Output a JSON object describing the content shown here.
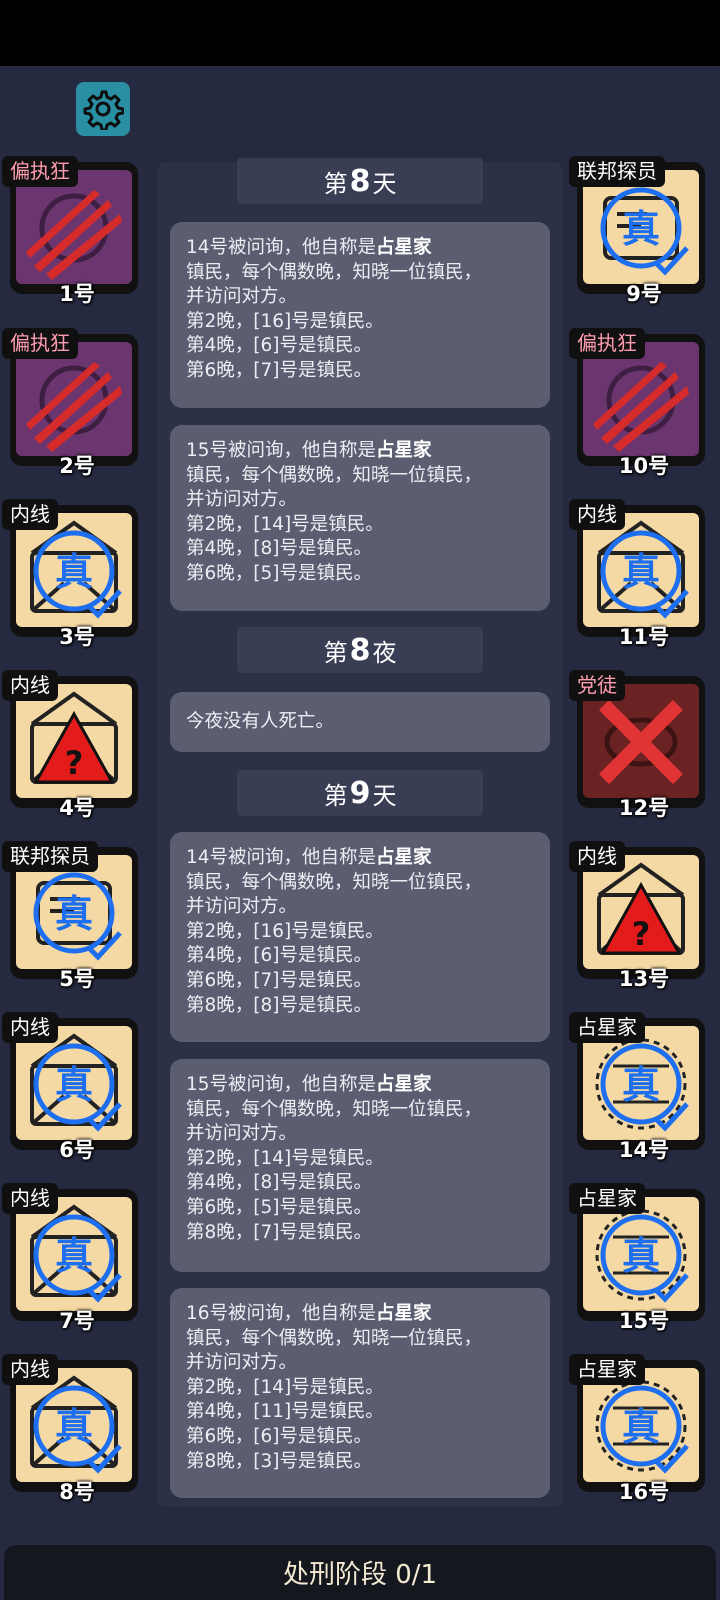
{
  "settings": {
    "icon": "gear-icon"
  },
  "log": {
    "headers": [
      {
        "prefix": "第",
        "number": "8",
        "suffix": "天"
      },
      {
        "prefix": "第",
        "number": "8",
        "suffix": "夜"
      },
      {
        "prefix": "第",
        "number": "9",
        "suffix": "天"
      }
    ],
    "cards": [
      {
        "intro": "14号被问询，他自称是",
        "role": "占星家",
        "lines": [
          "镇民，每个偶数晚，知晓一位镇民，",
          "并访问对方。",
          "第2晚，[16]号是镇民。",
          "第4晚，[6]号是镇民。",
          "第6晚，[7]号是镇民。"
        ]
      },
      {
        "intro": "15号被问询，他自称是",
        "role": "占星家",
        "lines": [
          "镇民，每个偶数晚，知晓一位镇民，",
          "并访问对方。",
          "第2晚，[14]号是镇民。",
          "第4晚，[8]号是镇民。",
          "第6晚，[5]号是镇民。"
        ]
      },
      {
        "intro": "今夜没有人死亡。",
        "role": "",
        "lines": []
      },
      {
        "intro": "14号被问询，他自称是",
        "role": "占星家",
        "lines": [
          "镇民，每个偶数晚，知晓一位镇民，",
          "并访问对方。",
          "第2晚，[16]号是镇民。",
          "第4晚，[6]号是镇民。",
          "第6晚，[7]号是镇民。",
          "第8晚，[8]号是镇民。"
        ]
      },
      {
        "intro": "15号被问询，他自称是",
        "role": "占星家",
        "lines": [
          "镇民，每个偶数晚，知晓一位镇民，",
          "并访问对方。",
          "第2晚，[14]号是镇民。",
          "第4晚，[8]号是镇民。",
          "第6晚，[5]号是镇民。",
          "第8晚，[7]号是镇民。"
        ]
      },
      {
        "intro": "16号被问询，他自称是",
        "role": "占星家",
        "lines": [
          "镇民，每个偶数晚，知晓一位镇民，",
          "并访问对方。",
          "第2晚，[14]号是镇民。",
          "第4晚，[11]号是镇民。",
          "第6晚，[6]号是镇民。",
          "第8晚，[3]号是镇民。"
        ]
      }
    ]
  },
  "players": [
    {
      "tag": "偏执狂",
      "number": "1号",
      "icon": "claw-mark-icon"
    },
    {
      "tag": "偏执狂",
      "number": "2号",
      "icon": "claw-mark-icon"
    },
    {
      "tag": "内线",
      "number": "3号",
      "icon": "verified-envelope-icon",
      "stamp": "真"
    },
    {
      "tag": "内线",
      "number": "4号",
      "icon": "warning-envelope-icon"
    },
    {
      "tag": "联邦探员",
      "number": "5号",
      "icon": "verified-badge-icon",
      "stamp": "真"
    },
    {
      "tag": "内线",
      "number": "6号",
      "icon": "verified-envelope-icon",
      "stamp": "真"
    },
    {
      "tag": "内线",
      "number": "7号",
      "icon": "verified-envelope-icon",
      "stamp": "真"
    },
    {
      "tag": "内线",
      "number": "8号",
      "icon": "verified-envelope-icon",
      "stamp": "真"
    },
    {
      "tag": "联邦探员",
      "number": "9号",
      "icon": "verified-badge-icon",
      "stamp": "真"
    },
    {
      "tag": "偏执狂",
      "number": "10号",
      "icon": "claw-mark-icon"
    },
    {
      "tag": "内线",
      "number": "11号",
      "icon": "verified-envelope-icon",
      "stamp": "真"
    },
    {
      "tag": "党徒",
      "number": "12号",
      "icon": "dead-cross-icon"
    },
    {
      "tag": "内线",
      "number": "13号",
      "icon": "warning-envelope-icon"
    },
    {
      "tag": "占星家",
      "number": "14号",
      "icon": "verified-astro-icon",
      "stamp": "真"
    },
    {
      "tag": "占星家",
      "number": "15号",
      "icon": "verified-astro-icon",
      "stamp": "真"
    },
    {
      "tag": "占星家",
      "number": "16号",
      "icon": "verified-astro-icon",
      "stamp": "真"
    }
  ],
  "footer": {
    "label": "处刑阶段 0/1"
  }
}
